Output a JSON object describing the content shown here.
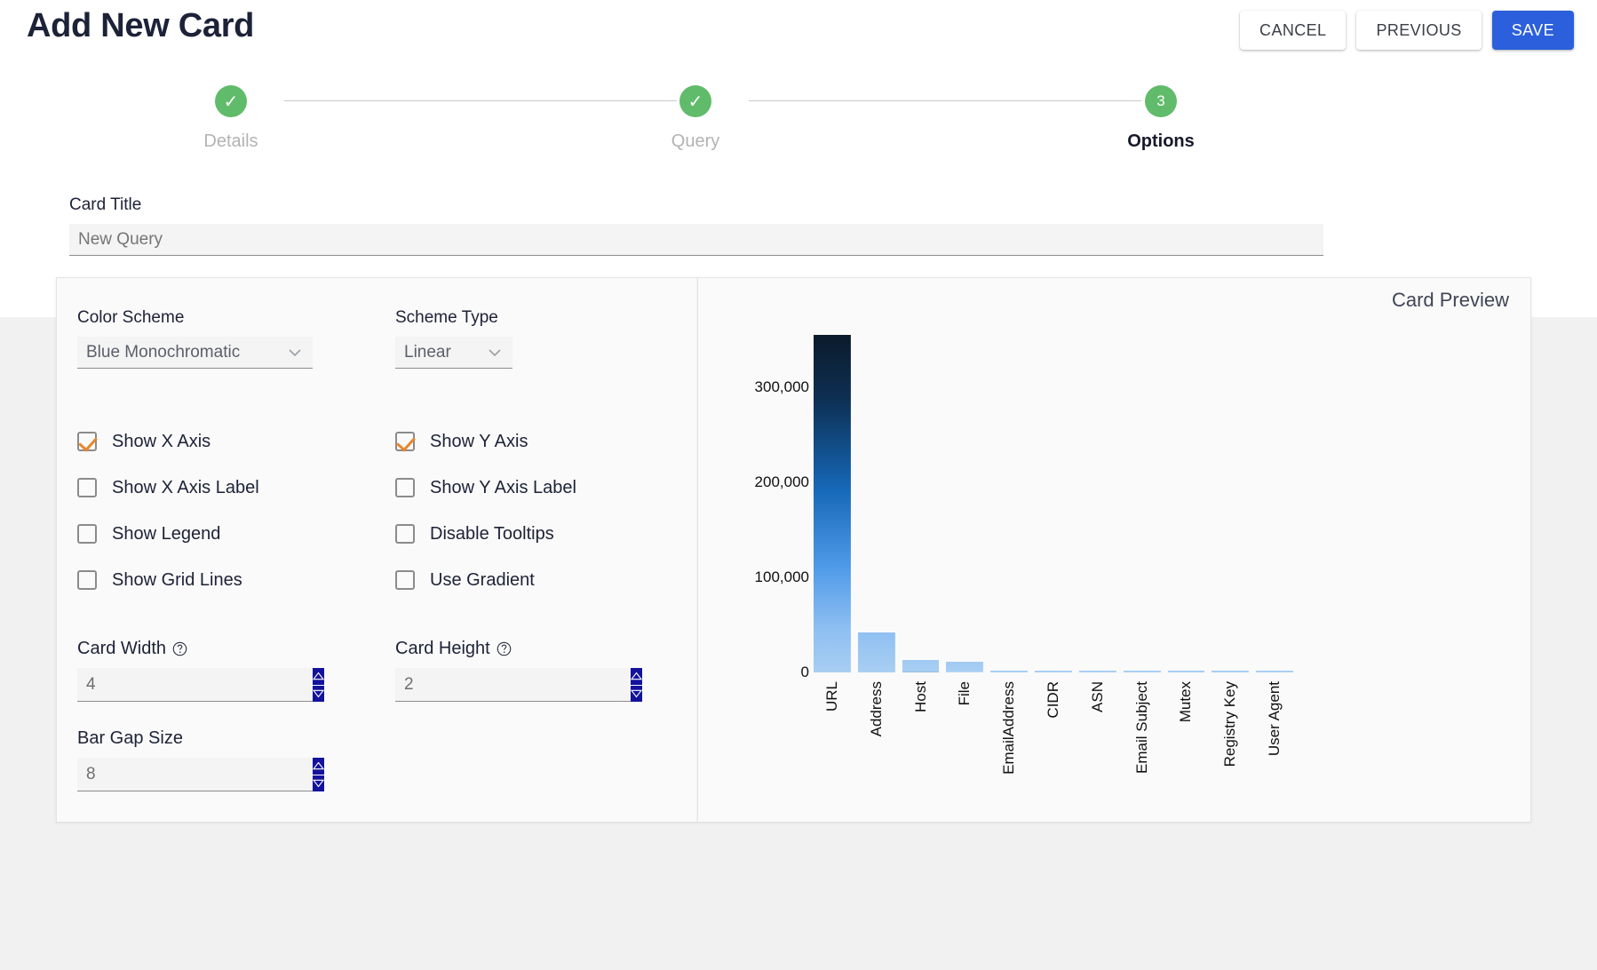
{
  "header": {
    "title": "Add New Card",
    "buttons": [
      {
        "label": "CANCEL",
        "name": "cancel-button",
        "style": "light"
      },
      {
        "label": "PREVIOUS",
        "name": "previous-button",
        "style": "light"
      },
      {
        "label": "SAVE",
        "name": "save-button",
        "style": "primary"
      }
    ]
  },
  "stepper": {
    "steps": [
      {
        "label": "Details",
        "marker": "✓",
        "state": "complete"
      },
      {
        "label": "Query",
        "marker": "✓",
        "state": "complete"
      },
      {
        "label": "Options",
        "marker": "3",
        "state": "current"
      }
    ]
  },
  "card_title": {
    "label": "Card Title",
    "value": "New Query",
    "placeholder": "New Query"
  },
  "options": {
    "color_scheme": {
      "label": "Color Scheme",
      "value": "Blue Monochromatic"
    },
    "scheme_type": {
      "label": "Scheme Type",
      "value": "Linear"
    },
    "checkboxes_left": [
      {
        "label": "Show X Axis",
        "checked": true
      },
      {
        "label": "Show X Axis Label",
        "checked": false
      },
      {
        "label": "Show Legend",
        "checked": false
      },
      {
        "label": "Show Grid Lines",
        "checked": false
      }
    ],
    "checkboxes_right": [
      {
        "label": "Show Y Axis",
        "checked": true
      },
      {
        "label": "Show Y Axis Label",
        "checked": false
      },
      {
        "label": "Disable Tooltips",
        "checked": false
      },
      {
        "label": "Use Gradient",
        "checked": false
      }
    ],
    "card_width": {
      "label": "Card Width",
      "value": "4",
      "has_help": true
    },
    "card_height": {
      "label": "Card Height",
      "value": "2",
      "has_help": true
    },
    "bar_gap_size": {
      "label": "Bar Gap Size",
      "value": "8",
      "has_help": false
    }
  },
  "preview": {
    "label": "Card Preview"
  },
  "colors": {
    "accent_blue": "#2b5fdb",
    "step_green": "#60bb6b",
    "checkbox_check": "#e8862a",
    "spinner_navy": "#13129c",
    "bar_top": "#0b1622",
    "bar_bottom": "#a8cef2"
  },
  "chart_data": {
    "type": "bar",
    "title": "",
    "xlabel": "",
    "ylabel": "",
    "categories": [
      "URL",
      "Address",
      "Host",
      "File",
      "EmailAddress",
      "CIDR",
      "ASN",
      "Email Subject",
      "Mutex",
      "Registry Key",
      "User Agent"
    ],
    "values": [
      355000,
      42000,
      13000,
      11000,
      2200,
      1800,
      1500,
      1200,
      1000,
      900,
      800
    ],
    "ytick_labels": [
      "300,000",
      "200,000",
      "100,000",
      "0"
    ],
    "ytick_values": [
      300000,
      200000,
      100000,
      0
    ],
    "ylim": [
      0,
      370000
    ],
    "grid": false,
    "legend": false,
    "gradient": "vertical-blue-monochromatic"
  }
}
